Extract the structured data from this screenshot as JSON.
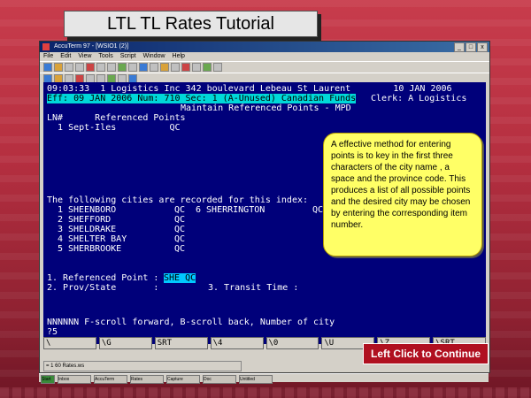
{
  "tutorial": {
    "title": "LTL TL Rates Tutorial",
    "continue_label": "Left Click to Continue",
    "callout_text": "A effective method for entering points is to key in the first three characters of the city name , a space and the province code. This produces a list of all possible points and the desired city may be chosen by entering the corresponding item number."
  },
  "window": {
    "title": "AccuTerm 97 - [WSIO1 (2)]",
    "menu": [
      "File",
      "Edit",
      "View",
      "Tools",
      "Script",
      "Window",
      "Help"
    ],
    "controls": [
      "_",
      "□",
      "x"
    ]
  },
  "terminal": {
    "header_line": "09:03:33  1 Logistics Inc 342 boulevard Lebeau St Laurent        10 JAN 2006",
    "eff_line": "Eff: 09 JAN 2006 Num: 710 Sec: 1 (A-Unused) Canadian Funds",
    "clerk": "Clerk: A Logistics",
    "screen_title": "Maintain Referenced Points - MPD",
    "list_header": "LN#      Referenced Points",
    "list_line1": "  1 Sept-Iles          QC",
    "cities_intro": "The following cities are recorded for this index:",
    "cities": [
      {
        "num": "1",
        "name": "SHEENBORO",
        "prov": "QC"
      },
      {
        "num": "2",
        "name": "SHEFFORD",
        "prov": "QC"
      },
      {
        "num": "3",
        "name": "SHELDRAKE",
        "prov": "QC"
      },
      {
        "num": "4",
        "name": "SHELTER BAY",
        "prov": "QC"
      },
      {
        "num": "5",
        "name": "SHERBROOKE",
        "prov": "QC"
      }
    ],
    "city6": "6 SHERRINGTON",
    "city6_prov": "QC",
    "field1_label": "1. Referenced Point :",
    "field1_value": "SHE QC",
    "field2_label": "2. Prov/State       :",
    "field3_label": "3. Transit Time :",
    "prompt_line": "NNNNNN F-scroll forward, B-scroll back, Number of city",
    "prompt": "?5"
  },
  "fkeys": [
    "\\",
    "\\G",
    "SRT",
    "\\4",
    "\\0",
    "\\U",
    "\\Z",
    "\\SRT"
  ],
  "statusbar": "= 1 60 Rates.ws",
  "taskbar": [
    "Start",
    "Inbox",
    "AccuTerm",
    "Rates",
    "Capture",
    "Doc",
    "Untitled"
  ]
}
